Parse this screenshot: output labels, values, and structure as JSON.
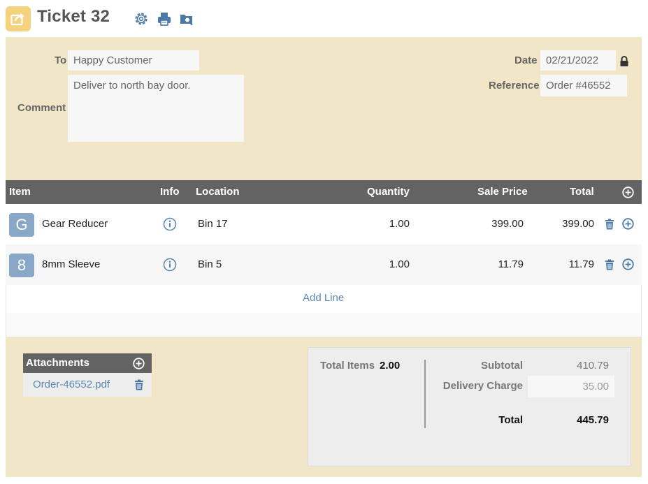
{
  "header": {
    "title": "Ticket 32",
    "icons": [
      "share-out-icon",
      "settings-gear-icon",
      "printer-icon",
      "preview-icon"
    ]
  },
  "form": {
    "to_label": "To",
    "to_value": "Happy Customer",
    "comment_label": "Comment",
    "comment_value": "Deliver to north bay door.",
    "date_label": "Date",
    "date_value": "02/21/2022",
    "reference_label": "Reference",
    "reference_value": "Order #46552"
  },
  "table": {
    "columns": [
      "Item",
      "Info",
      "Location",
      "Quantity",
      "Sale Price",
      "Total"
    ],
    "rows": [
      {
        "badge": "G",
        "item": "Gear Reducer",
        "location": "Bin 17",
        "quantity": "1.00",
        "sale_price": "399.00",
        "total": "399.00"
      },
      {
        "badge": "8",
        "item": "8mm Sleeve",
        "location": "Bin 5",
        "quantity": "1.00",
        "sale_price": "11.79",
        "total": "11.79"
      }
    ],
    "add_line_label": "Add Line"
  },
  "attachments": {
    "title": "Attachments",
    "files": [
      "Order-46552.pdf"
    ]
  },
  "totals": {
    "total_items_label": "Total Items",
    "total_items_value": "2.00",
    "subtotal_label": "Subtotal",
    "subtotal_value": "410.79",
    "delivery_label": "Delivery Charge",
    "delivery_value": "35.00",
    "total_label": "Total",
    "total_value": "445.79"
  },
  "colors": {
    "accent_yellow": "#f4d27e",
    "panel_beige": "#f2e6c8",
    "header_gray": "#636363",
    "link_blue": "#5a89b3",
    "icon_blue": "#4b7aa6"
  }
}
